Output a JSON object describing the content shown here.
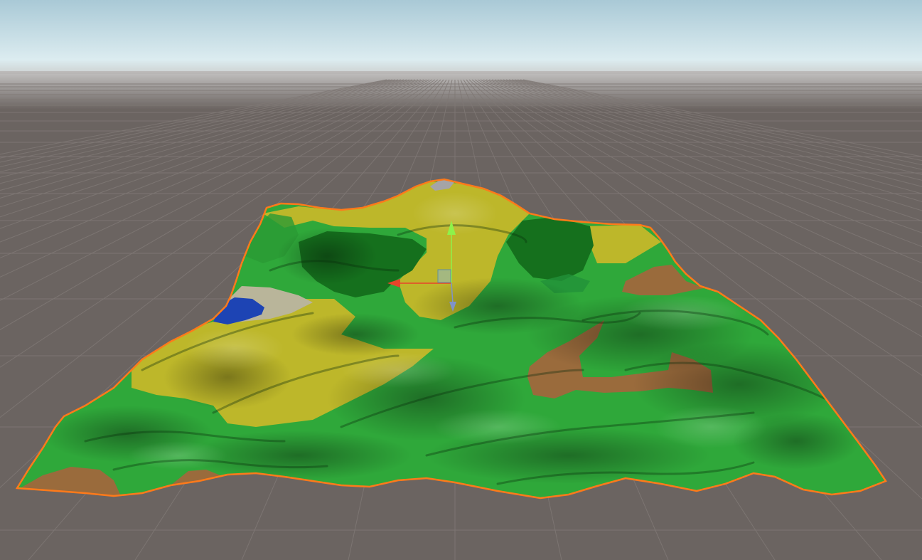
{
  "scene": {
    "colors": {
      "sky_top": "#a9c9d6",
      "sky_horizon": "#dcecf0",
      "haze": "#c7c6c4",
      "ground": "#6b6461",
      "grid_line": "#7f7875",
      "selection_outline": "#ff7a1a",
      "terrain_grass": "#2fa83a",
      "terrain_forest": "#15701d",
      "terrain_meadow": "#bdb72a",
      "terrain_dirt": "#9a6b3c",
      "terrain_water": "#1d44b4",
      "terrain_sand": "#b9b59a",
      "terrain_rock": "#a5a4a6",
      "gizmo_y_axis": "#8ef24a",
      "gizmo_x_axis": "#e8442a",
      "gizmo_z_axis": "#7f93c8",
      "gizmo_plane_handle": "#8fb9c6"
    },
    "icons": {
      "y_axis": "y-axis-arrow-icon",
      "x_axis": "x-axis-arrow-icon",
      "z_axis": "z-axis-arrow-icon",
      "plane": "plane-handle-icon"
    }
  }
}
